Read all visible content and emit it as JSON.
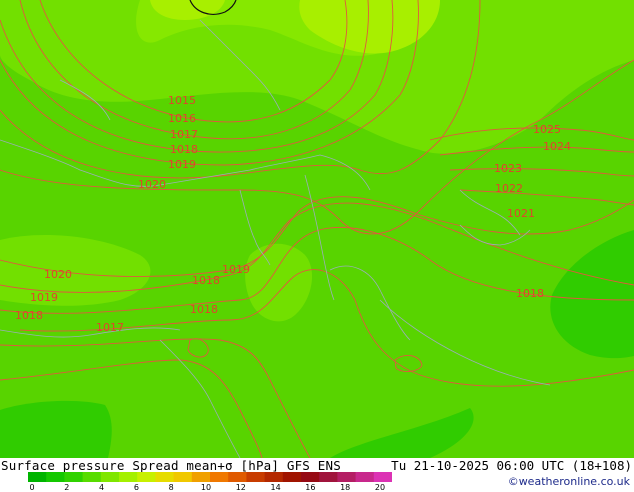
{
  "map": {
    "isobar_labels": [
      "1015",
      "1016",
      "1017",
      "1018",
      "1019",
      "1020",
      "1025",
      "1024",
      "1023",
      "1022",
      "1021",
      "1018",
      "1020",
      "1019",
      "1018",
      "1018",
      "1019",
      "1018",
      "1017",
      "1016"
    ]
  },
  "footer": {
    "title": "Surface pressure Spread mean+σ [hPa] GFS ENS",
    "datetime": "Tu 21-10-2025 06:00 UTC (18+108)",
    "credit": "©weatheronline.co.uk"
  },
  "colorbar": {
    "colors": [
      "#00b400",
      "#14c800",
      "#30d200",
      "#58dc00",
      "#80e600",
      "#a4f000",
      "#c8f000",
      "#e6dc00",
      "#f0c800",
      "#f0a000",
      "#f07800",
      "#e05a00",
      "#c83c00",
      "#b42800",
      "#a01400",
      "#960a14",
      "#a0143c",
      "#b41e64",
      "#c8288c",
      "#dc32b4"
    ],
    "ticks": [
      "0",
      "2",
      "4",
      "6",
      "8",
      "10",
      "12",
      "14",
      "16",
      "18",
      "20"
    ]
  }
}
